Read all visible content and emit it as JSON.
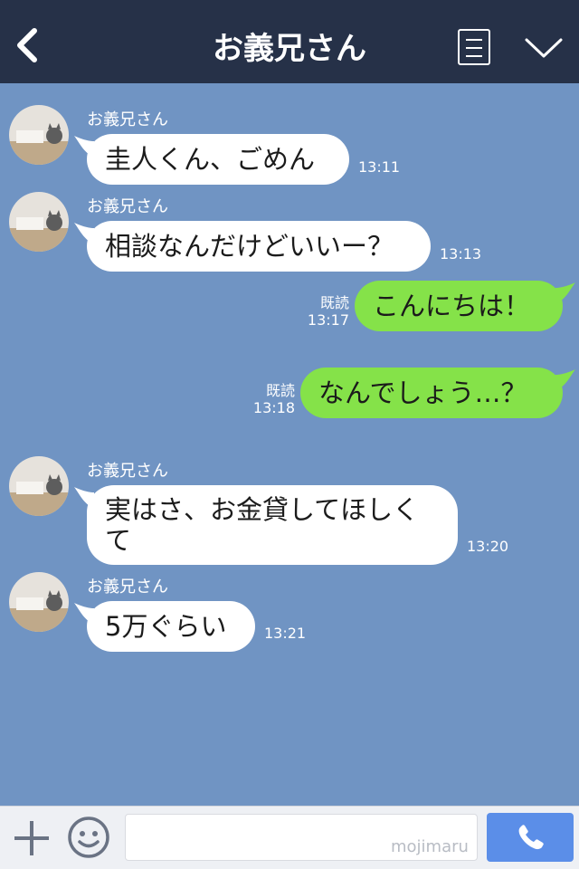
{
  "header": {
    "title": "お義兄さん",
    "back_icon": "chevron-left-icon",
    "menu_icon": "menu-list-icon",
    "collapse_icon": "chevron-down-icon"
  },
  "messages": [
    {
      "direction": "in",
      "sender": "お義兄さん",
      "text": "圭人くん、ごめん",
      "time": "13:11"
    },
    {
      "direction": "in",
      "sender": "お義兄さん",
      "text": "相談なんだけどいいー？",
      "time": "13:13"
    },
    {
      "direction": "out",
      "read": "既読",
      "text": "こんにちは！",
      "time": "13:17"
    },
    {
      "direction": "out",
      "read": "既読",
      "text": "なんでしょう…？",
      "time": "13:18"
    },
    {
      "direction": "in",
      "sender": "お義兄さん",
      "text": "実はさ、お金貸してほしくて",
      "time": "13:20"
    },
    {
      "direction": "in",
      "sender": "お義兄さん",
      "text": "5万ぐらい",
      "time": "13:21"
    }
  ],
  "footer": {
    "plus_icon": "plus-icon",
    "emoji_icon": "smiley-icon",
    "input_value": "",
    "watermark": "mojimaru",
    "call_icon": "phone-icon"
  },
  "colors": {
    "header_bg": "#263148",
    "chat_bg": "#7094c3",
    "incoming_bubble": "#ffffff",
    "outgoing_bubble": "#85e249",
    "call_button": "#5b8ee8"
  }
}
